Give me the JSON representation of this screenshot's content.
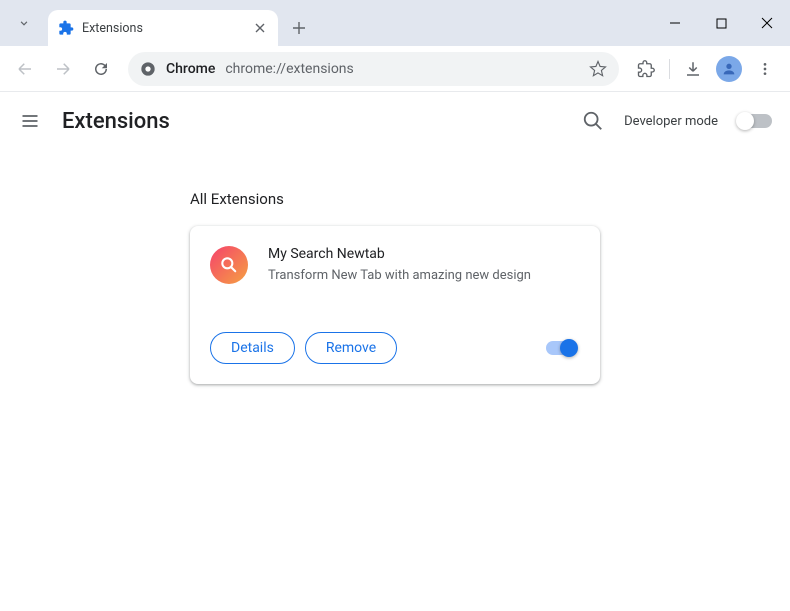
{
  "window": {
    "tab_title": "Extensions"
  },
  "toolbar": {
    "url": "chrome://extensions",
    "origin_label": "Chrome"
  },
  "header": {
    "title": "Extensions",
    "dev_mode_label": "Developer mode"
  },
  "content": {
    "section_title": "All Extensions",
    "extension": {
      "name": "My Search Newtab",
      "description": "Transform New Tab with amazing new design",
      "details_label": "Details",
      "remove_label": "Remove"
    }
  }
}
